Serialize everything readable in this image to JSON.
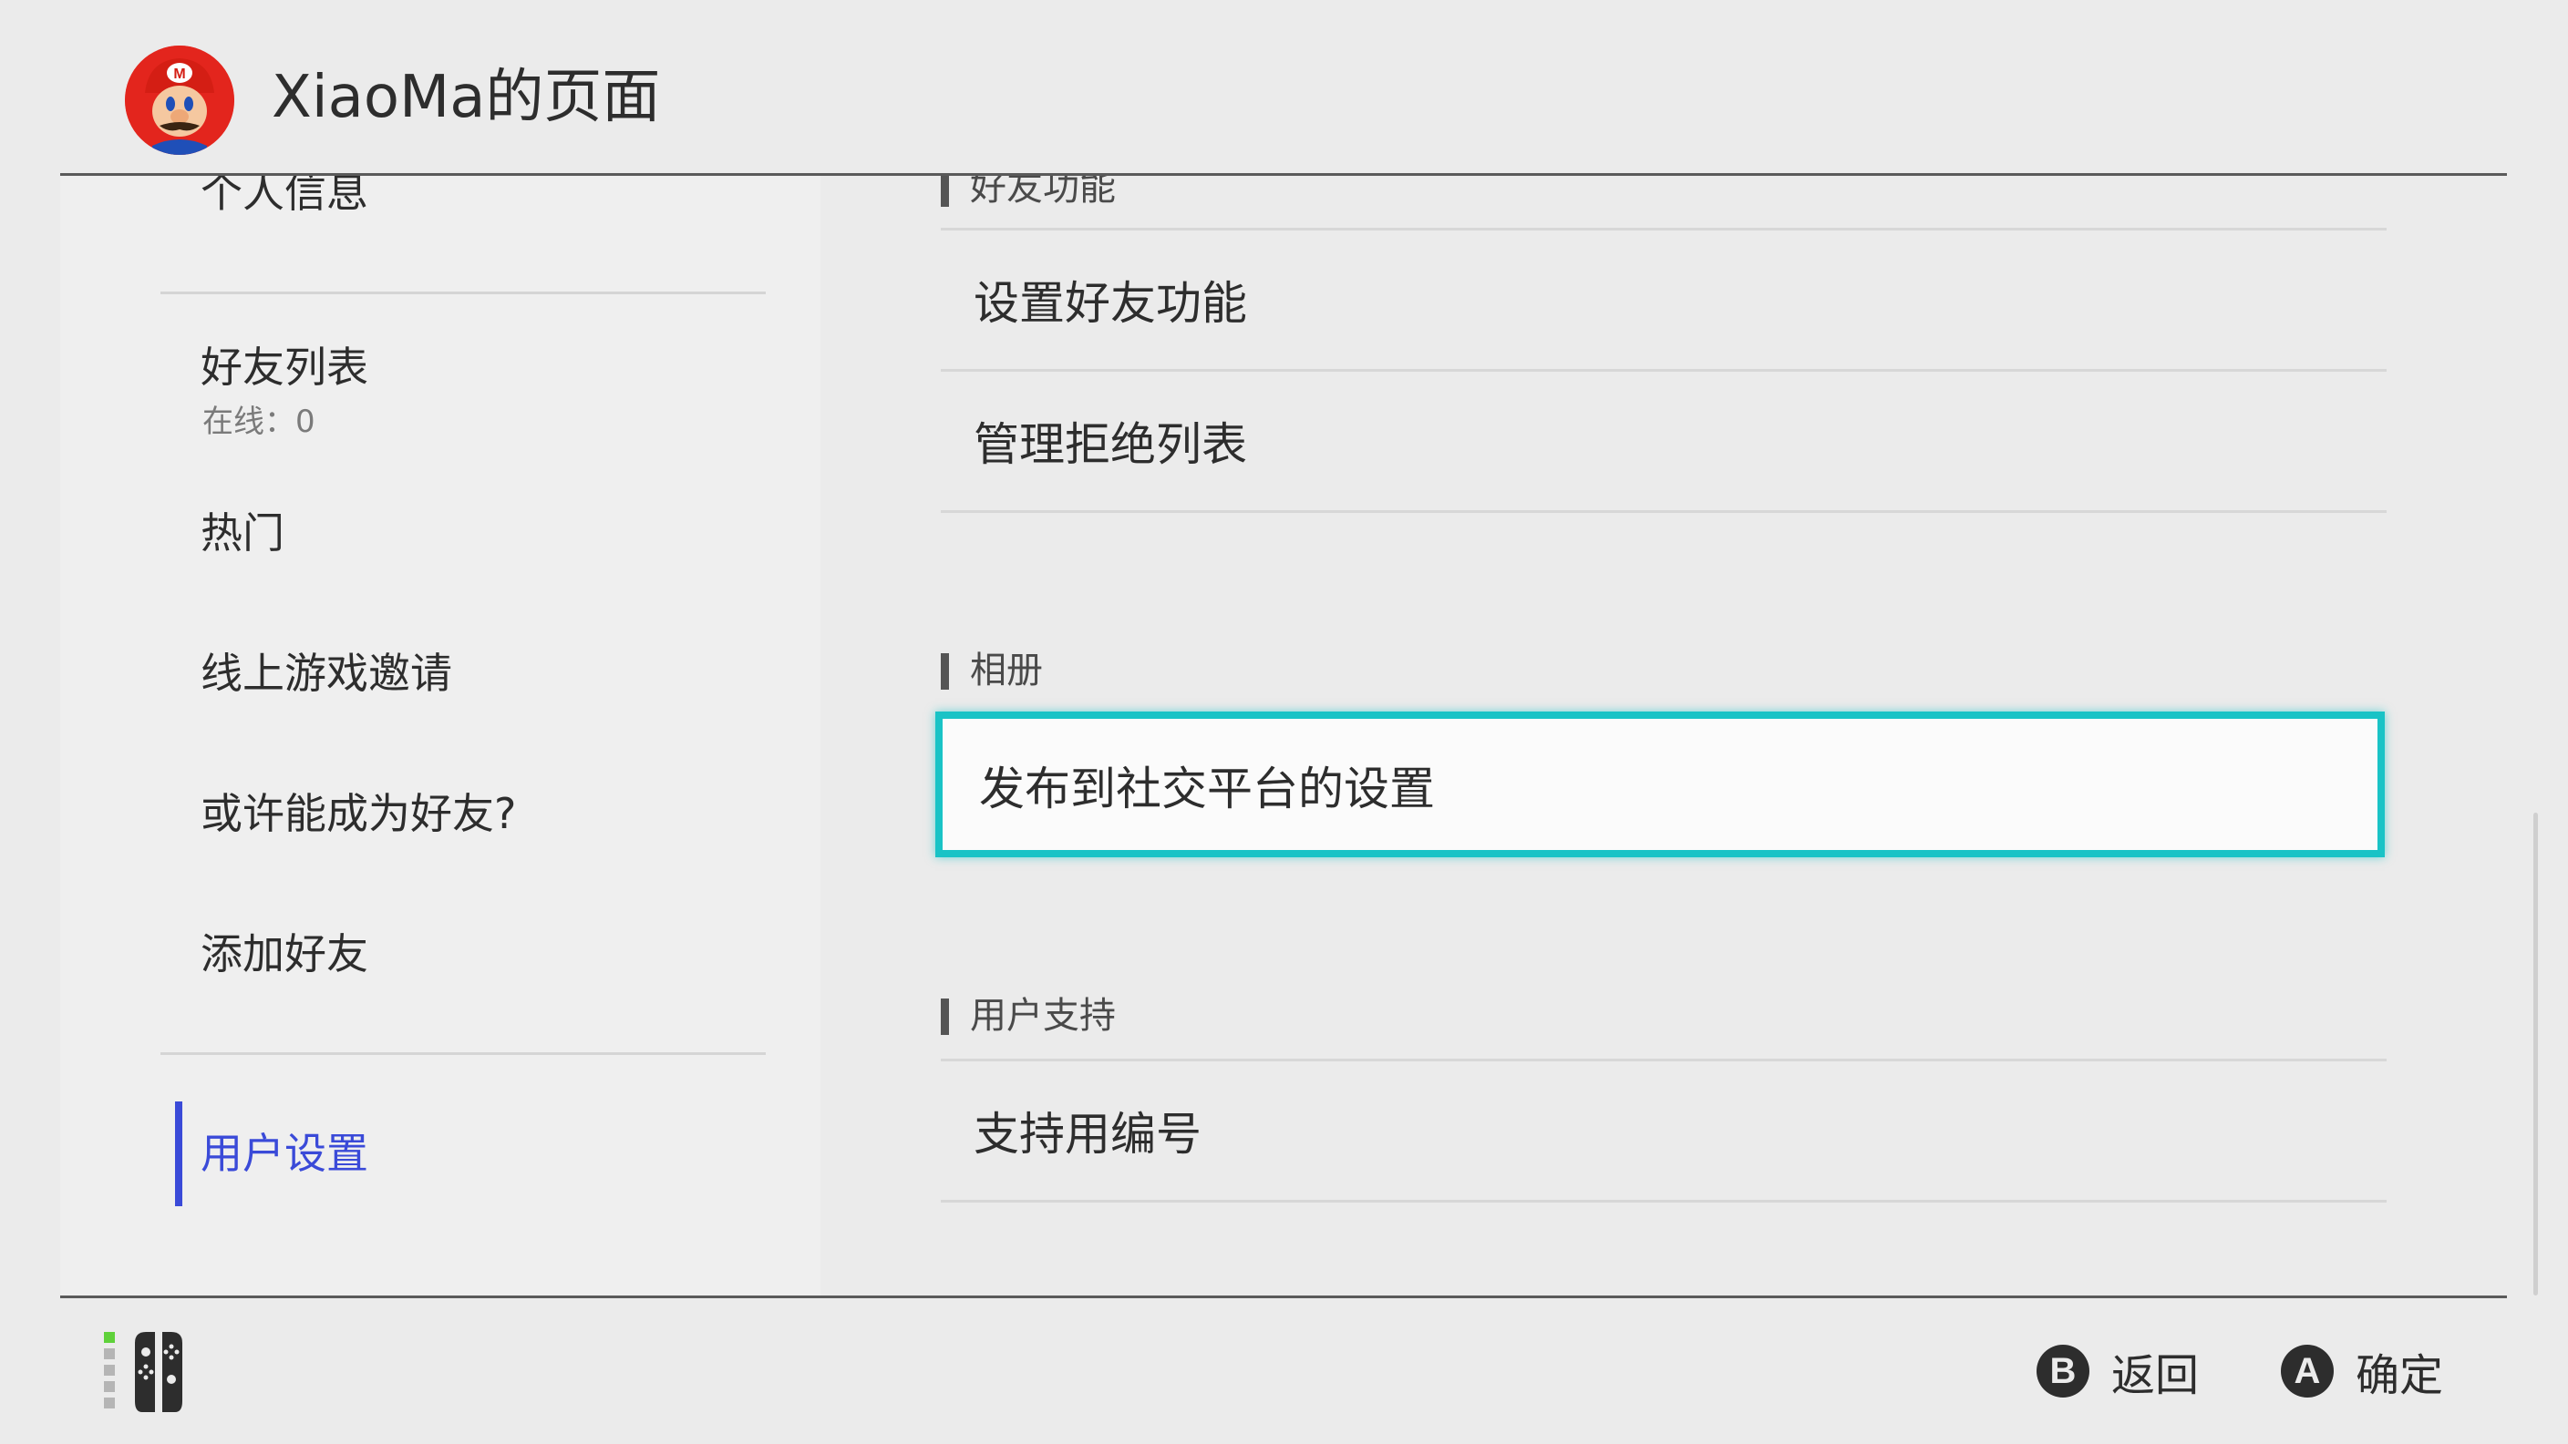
{
  "header": {
    "title": "XiaoMa的页面",
    "avatar": "mario-avatar"
  },
  "sidebar": {
    "items": [
      {
        "label": "个人信息"
      },
      {
        "label": "好友列表",
        "sub": "在线：0"
      },
      {
        "label": "热门"
      },
      {
        "label": "线上游戏邀请"
      },
      {
        "label": "或许能成为好友?"
      },
      {
        "label": "添加好友"
      },
      {
        "label": "用户设置",
        "active": true
      }
    ]
  },
  "main": {
    "sections": [
      {
        "heading": "好友功能",
        "rows": [
          "设置好友功能",
          "管理拒绝列表"
        ]
      },
      {
        "heading": "相册",
        "rows": [
          "发布到社交平台的设置"
        ]
      },
      {
        "heading": "用户支持",
        "rows": [
          "支持用编号"
        ]
      }
    ]
  },
  "footer": {
    "back": {
      "glyph": "B",
      "label": "返回"
    },
    "ok": {
      "glyph": "A",
      "label": "确定"
    }
  },
  "colors": {
    "accent": "#3a4ad8",
    "selection": "#19c3c6",
    "background": "#ebebeb"
  }
}
